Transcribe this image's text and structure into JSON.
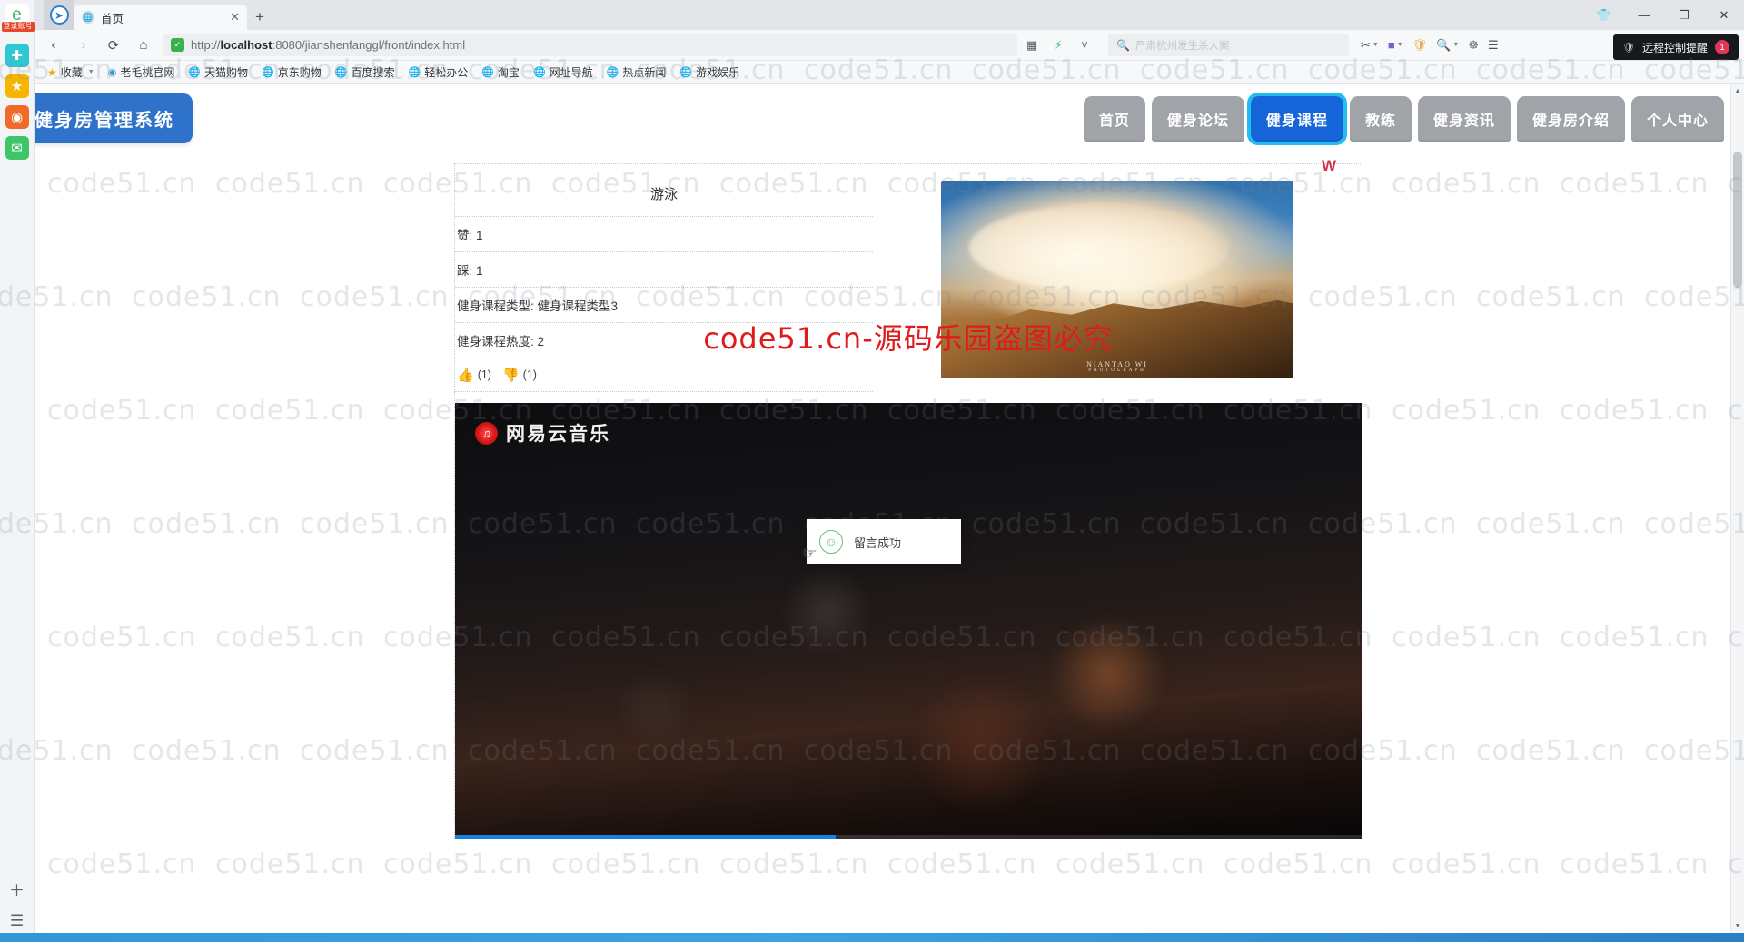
{
  "browser": {
    "tab": {
      "title": "首页",
      "favicon_icon": "globe-icon",
      "close_icon": "✕"
    },
    "new_tab_icon": "+",
    "window_controls": {
      "shirt": "👕",
      "minimize": "—",
      "maximize": "❐",
      "close": "✕"
    },
    "nav": {
      "back_icon": "‹",
      "forward_icon": "›",
      "reload_icon": "⟳",
      "home_icon": "⌂"
    },
    "url": {
      "prefix": "http://",
      "host": "localhost",
      "rest": ":8080/jianshenfanggl/front/index.html",
      "shield_icon": "🛡"
    },
    "addr_tools": [
      "grid-icon",
      "lightning-icon",
      "chevron-down-icon"
    ],
    "search": {
      "icon": "search-icon",
      "placeholder": "严肃杭州发生杀人案"
    },
    "right_tools": [
      "scissors-icon",
      "palette-icon",
      "shield-guard-icon",
      "magnifier-icon",
      "puzzle-icon",
      "menu-icon"
    ],
    "remote_notice": {
      "icon": "shield-icon",
      "text": "远程控制提醒",
      "badge": "1"
    }
  },
  "dock": {
    "items": [
      {
        "name": "ie-browser-icon",
        "glyph": "e",
        "badge": "登录账号",
        "color": "#ffffff",
        "text_color": "#35b45d"
      },
      {
        "name": "health-icon",
        "glyph": "✚",
        "color": "#2ec8d4"
      },
      {
        "name": "favorites-star-icon",
        "glyph": "★",
        "color": "#f7b500"
      },
      {
        "name": "weibo-icon",
        "glyph": "◉",
        "color": "#f06a2a"
      },
      {
        "name": "mail-icon",
        "glyph": "✉",
        "color": "#3fc46a"
      }
    ],
    "bottom": [
      {
        "name": "add-icon",
        "glyph": "＋"
      },
      {
        "name": "list-icon",
        "glyph": "☰"
      }
    ]
  },
  "bookmarks": [
    {
      "label": "收藏",
      "icon": "star-icon",
      "has_caret": true
    },
    {
      "label": "老毛桃官网",
      "icon": "globe-icon"
    },
    {
      "label": "天猫购物",
      "icon": "globe-icon"
    },
    {
      "label": "京东购物",
      "icon": "globe-icon"
    },
    {
      "label": "百度搜索",
      "icon": "globe-icon"
    },
    {
      "label": "轻松办公",
      "icon": "globe-icon"
    },
    {
      "label": "淘宝",
      "icon": "globe-icon"
    },
    {
      "label": "网址导航",
      "icon": "globe-icon"
    },
    {
      "label": "热点新闻",
      "icon": "globe-icon"
    },
    {
      "label": "游戏娱乐",
      "icon": "globe-icon"
    }
  ],
  "site": {
    "logo": "健身房管理系统",
    "nav": [
      {
        "label": "首页",
        "active": false
      },
      {
        "label": "健身论坛",
        "active": false
      },
      {
        "label": "健身课程",
        "active": true
      },
      {
        "label": "教练",
        "active": false
      },
      {
        "label": "健身资讯",
        "active": false
      },
      {
        "label": "健身房介绍",
        "active": false
      },
      {
        "label": "个人中心",
        "active": false
      }
    ],
    "accent_blue": "#1565d8",
    "accent_cyan": "#21bdf0",
    "logo_blue": "#2f72c9"
  },
  "detail": {
    "title": "游泳",
    "rows": [
      {
        "label": "赞",
        "value": "1",
        "text": "赞: 1"
      },
      {
        "label": "踩",
        "value": "1",
        "text": "踩: 1"
      },
      {
        "label": "健身课程类型",
        "value": "健身课程类型3",
        "text": "健身课程类型: 健身课程类型3"
      },
      {
        "label": "健身课程热度",
        "value": "2",
        "text": "健身课程热度: 2"
      }
    ],
    "vote": {
      "up_icon": "thumbs-up-icon",
      "up_count": "(1)",
      "down_icon": "thumbs-down-icon",
      "down_count": "(1)"
    },
    "photo_credit": "NIANTAO WI",
    "photo_credit_sub": "PHOTOGRAPH",
    "card_mark": "W"
  },
  "video": {
    "brand": "网易云音乐",
    "brand_icon": "netease-music-icon",
    "progress_percent": "42"
  },
  "toast": {
    "icon": "smiley-icon",
    "glyph": "☺",
    "message": "留言成功",
    "accent": "#5fbf78"
  },
  "cursor_glyph": "☞",
  "watermark": {
    "tile_text": "code51.cn",
    "banner_text": "code51.cn-源码乐园盗图必究",
    "banner_color": "#e01b1b"
  },
  "scrollbar": {
    "up_icon": "▲",
    "down_icon": "▼"
  }
}
